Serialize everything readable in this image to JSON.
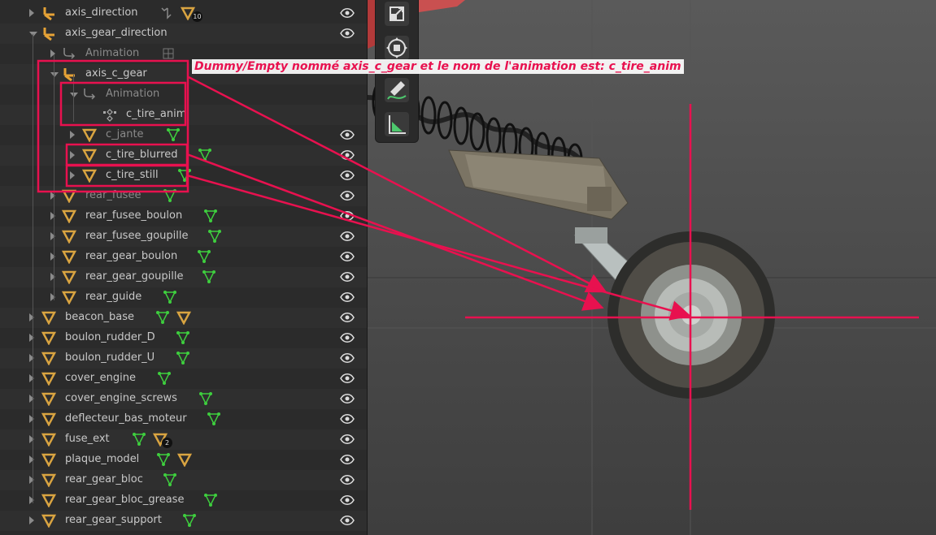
{
  "annotation": {
    "text": "Dummy/Empty nommé axis_c_gear et le nom de l'animation est: c_tire_anim",
    "color": "#e8114f"
  },
  "colors": {
    "empty_orange": "#e5a236",
    "mesh_orange": "#d9a441",
    "modifier_green": "#3ecf3e",
    "highlight_red": "#e8114f"
  },
  "outliner": {
    "rows": [
      {
        "label": "axis_direction",
        "icon": "empty-axis-icon",
        "badge": "10"
      },
      {
        "label": "axis_gear_direction",
        "icon": "empty-axis-icon"
      },
      {
        "label": "Animation",
        "icon": "animation-icon"
      },
      {
        "label": "axis_c_gear",
        "icon": "empty-axis-icon"
      },
      {
        "label": "Animation",
        "icon": "animation-icon"
      },
      {
        "label": "c_tire_anim",
        "icon": "action-icon"
      },
      {
        "label": "c_jante",
        "icon": "mesh-icon"
      },
      {
        "label": "c_tire_blurred",
        "icon": "mesh-icon"
      },
      {
        "label": "c_tire_still",
        "icon": "mesh-icon"
      },
      {
        "label": "rear_fusee",
        "icon": "mesh-icon"
      },
      {
        "label": "rear_fusee_boulon",
        "icon": "mesh-icon"
      },
      {
        "label": "rear_fusee_goupille",
        "icon": "mesh-icon"
      },
      {
        "label": "rear_gear_boulon",
        "icon": "mesh-icon"
      },
      {
        "label": "rear_gear_goupille",
        "icon": "mesh-icon"
      },
      {
        "label": "rear_guide",
        "icon": "mesh-icon"
      },
      {
        "label": "beacon_base",
        "icon": "mesh-icon"
      },
      {
        "label": "boulon_rudder_D",
        "icon": "mesh-icon"
      },
      {
        "label": "boulon_rudder_U",
        "icon": "mesh-icon"
      },
      {
        "label": "cover_engine",
        "icon": "mesh-icon"
      },
      {
        "label": "cover_engine_screws",
        "icon": "mesh-icon"
      },
      {
        "label": "deflecteur_bas_moteur",
        "icon": "mesh-icon"
      },
      {
        "label": "fuse_ext",
        "icon": "mesh-icon",
        "badge": "2"
      },
      {
        "label": "plaque_model",
        "icon": "mesh-icon"
      },
      {
        "label": "rear_gear_bloc",
        "icon": "mesh-icon"
      },
      {
        "label": "rear_gear_bloc_grease",
        "icon": "mesh-icon"
      },
      {
        "label": "rear_gear_support",
        "icon": "mesh-icon"
      }
    ]
  },
  "viewport_tools": [
    "scale-icon",
    "transform-icon",
    "annotate-icon",
    "measure-icon"
  ]
}
